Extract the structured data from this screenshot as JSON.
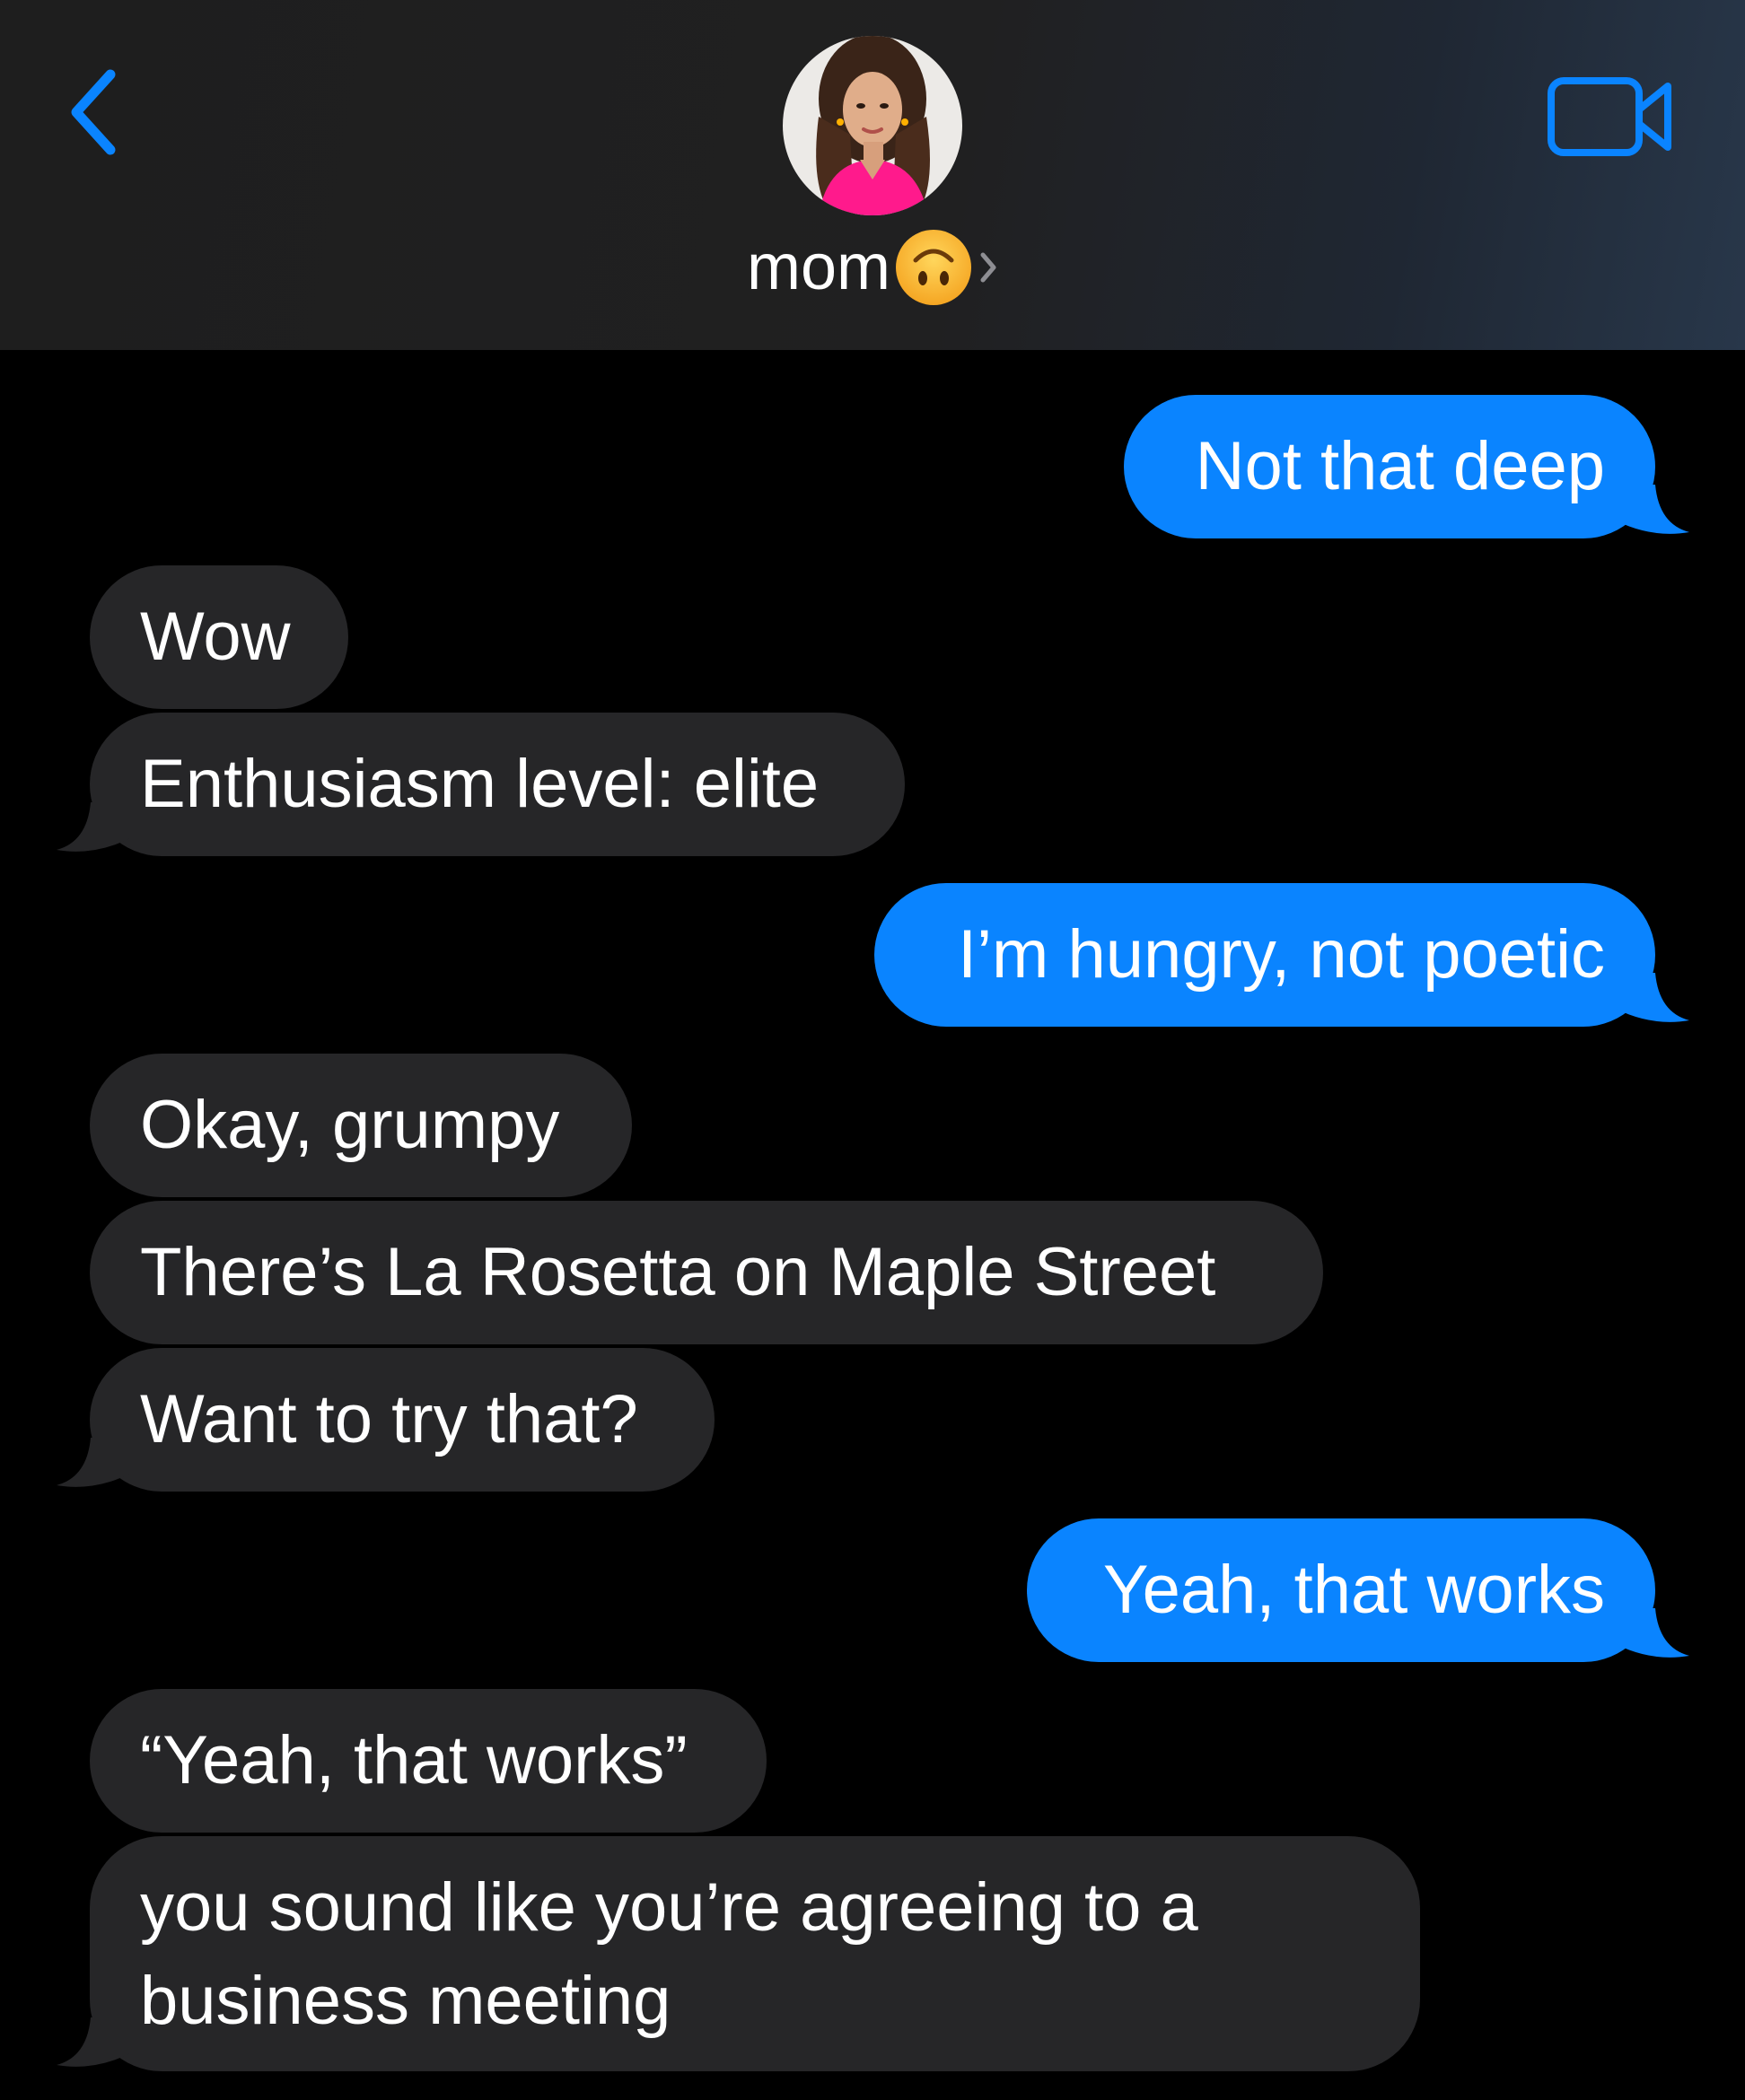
{
  "header": {
    "contact_name": "mom",
    "contact_emoji": "upside-down-face-emoji",
    "back_icon": "chevron-left-icon",
    "video_icon": "video-camera-icon",
    "accent_color": "#0a84ff"
  },
  "messages": [
    {
      "direction": "sent",
      "text": "Not that deep"
    },
    {
      "direction": "received",
      "text": "Wow"
    },
    {
      "direction": "received",
      "text": "Enthusiasm level: elite"
    },
    {
      "direction": "sent",
      "text": "I’m hungry, not poetic"
    },
    {
      "direction": "received",
      "text": "Okay, grumpy"
    },
    {
      "direction": "received",
      "text": "There’s La Rosetta on Maple Street"
    },
    {
      "direction": "received",
      "text": "Want to try that?"
    },
    {
      "direction": "sent",
      "text": "Yeah, that works"
    },
    {
      "direction": "received",
      "text": "“Yeah, that works”"
    },
    {
      "direction": "received",
      "text": "you sound like you’re agreeing to a business meeting"
    }
  ],
  "colors": {
    "sent_bubble": "#0a84ff",
    "received_bubble": "#262628",
    "background": "#000000"
  }
}
